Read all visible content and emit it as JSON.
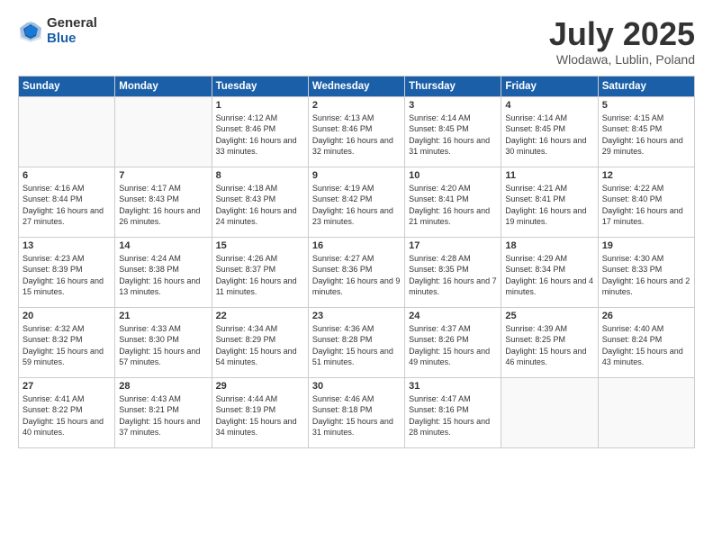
{
  "header": {
    "logo_general": "General",
    "logo_blue": "Blue",
    "month": "July 2025",
    "location": "Wlodawa, Lublin, Poland"
  },
  "days_of_week": [
    "Sunday",
    "Monday",
    "Tuesday",
    "Wednesday",
    "Thursday",
    "Friday",
    "Saturday"
  ],
  "weeks": [
    [
      {
        "day": "",
        "content": ""
      },
      {
        "day": "",
        "content": ""
      },
      {
        "day": "1",
        "content": "Sunrise: 4:12 AM\nSunset: 8:46 PM\nDaylight: 16 hours\nand 33 minutes."
      },
      {
        "day": "2",
        "content": "Sunrise: 4:13 AM\nSunset: 8:46 PM\nDaylight: 16 hours\nand 32 minutes."
      },
      {
        "day": "3",
        "content": "Sunrise: 4:14 AM\nSunset: 8:45 PM\nDaylight: 16 hours\nand 31 minutes."
      },
      {
        "day": "4",
        "content": "Sunrise: 4:14 AM\nSunset: 8:45 PM\nDaylight: 16 hours\nand 30 minutes."
      },
      {
        "day": "5",
        "content": "Sunrise: 4:15 AM\nSunset: 8:45 PM\nDaylight: 16 hours\nand 29 minutes."
      }
    ],
    [
      {
        "day": "6",
        "content": "Sunrise: 4:16 AM\nSunset: 8:44 PM\nDaylight: 16 hours\nand 27 minutes."
      },
      {
        "day": "7",
        "content": "Sunrise: 4:17 AM\nSunset: 8:43 PM\nDaylight: 16 hours\nand 26 minutes."
      },
      {
        "day": "8",
        "content": "Sunrise: 4:18 AM\nSunset: 8:43 PM\nDaylight: 16 hours\nand 24 minutes."
      },
      {
        "day": "9",
        "content": "Sunrise: 4:19 AM\nSunset: 8:42 PM\nDaylight: 16 hours\nand 23 minutes."
      },
      {
        "day": "10",
        "content": "Sunrise: 4:20 AM\nSunset: 8:41 PM\nDaylight: 16 hours\nand 21 minutes."
      },
      {
        "day": "11",
        "content": "Sunrise: 4:21 AM\nSunset: 8:41 PM\nDaylight: 16 hours\nand 19 minutes."
      },
      {
        "day": "12",
        "content": "Sunrise: 4:22 AM\nSunset: 8:40 PM\nDaylight: 16 hours\nand 17 minutes."
      }
    ],
    [
      {
        "day": "13",
        "content": "Sunrise: 4:23 AM\nSunset: 8:39 PM\nDaylight: 16 hours\nand 15 minutes."
      },
      {
        "day": "14",
        "content": "Sunrise: 4:24 AM\nSunset: 8:38 PM\nDaylight: 16 hours\nand 13 minutes."
      },
      {
        "day": "15",
        "content": "Sunrise: 4:26 AM\nSunset: 8:37 PM\nDaylight: 16 hours\nand 11 minutes."
      },
      {
        "day": "16",
        "content": "Sunrise: 4:27 AM\nSunset: 8:36 PM\nDaylight: 16 hours\nand 9 minutes."
      },
      {
        "day": "17",
        "content": "Sunrise: 4:28 AM\nSunset: 8:35 PM\nDaylight: 16 hours\nand 7 minutes."
      },
      {
        "day": "18",
        "content": "Sunrise: 4:29 AM\nSunset: 8:34 PM\nDaylight: 16 hours\nand 4 minutes."
      },
      {
        "day": "19",
        "content": "Sunrise: 4:30 AM\nSunset: 8:33 PM\nDaylight: 16 hours\nand 2 minutes."
      }
    ],
    [
      {
        "day": "20",
        "content": "Sunrise: 4:32 AM\nSunset: 8:32 PM\nDaylight: 15 hours\nand 59 minutes."
      },
      {
        "day": "21",
        "content": "Sunrise: 4:33 AM\nSunset: 8:30 PM\nDaylight: 15 hours\nand 57 minutes."
      },
      {
        "day": "22",
        "content": "Sunrise: 4:34 AM\nSunset: 8:29 PM\nDaylight: 15 hours\nand 54 minutes."
      },
      {
        "day": "23",
        "content": "Sunrise: 4:36 AM\nSunset: 8:28 PM\nDaylight: 15 hours\nand 51 minutes."
      },
      {
        "day": "24",
        "content": "Sunrise: 4:37 AM\nSunset: 8:26 PM\nDaylight: 15 hours\nand 49 minutes."
      },
      {
        "day": "25",
        "content": "Sunrise: 4:39 AM\nSunset: 8:25 PM\nDaylight: 15 hours\nand 46 minutes."
      },
      {
        "day": "26",
        "content": "Sunrise: 4:40 AM\nSunset: 8:24 PM\nDaylight: 15 hours\nand 43 minutes."
      }
    ],
    [
      {
        "day": "27",
        "content": "Sunrise: 4:41 AM\nSunset: 8:22 PM\nDaylight: 15 hours\nand 40 minutes."
      },
      {
        "day": "28",
        "content": "Sunrise: 4:43 AM\nSunset: 8:21 PM\nDaylight: 15 hours\nand 37 minutes."
      },
      {
        "day": "29",
        "content": "Sunrise: 4:44 AM\nSunset: 8:19 PM\nDaylight: 15 hours\nand 34 minutes."
      },
      {
        "day": "30",
        "content": "Sunrise: 4:46 AM\nSunset: 8:18 PM\nDaylight: 15 hours\nand 31 minutes."
      },
      {
        "day": "31",
        "content": "Sunrise: 4:47 AM\nSunset: 8:16 PM\nDaylight: 15 hours\nand 28 minutes."
      },
      {
        "day": "",
        "content": ""
      },
      {
        "day": "",
        "content": ""
      }
    ]
  ]
}
